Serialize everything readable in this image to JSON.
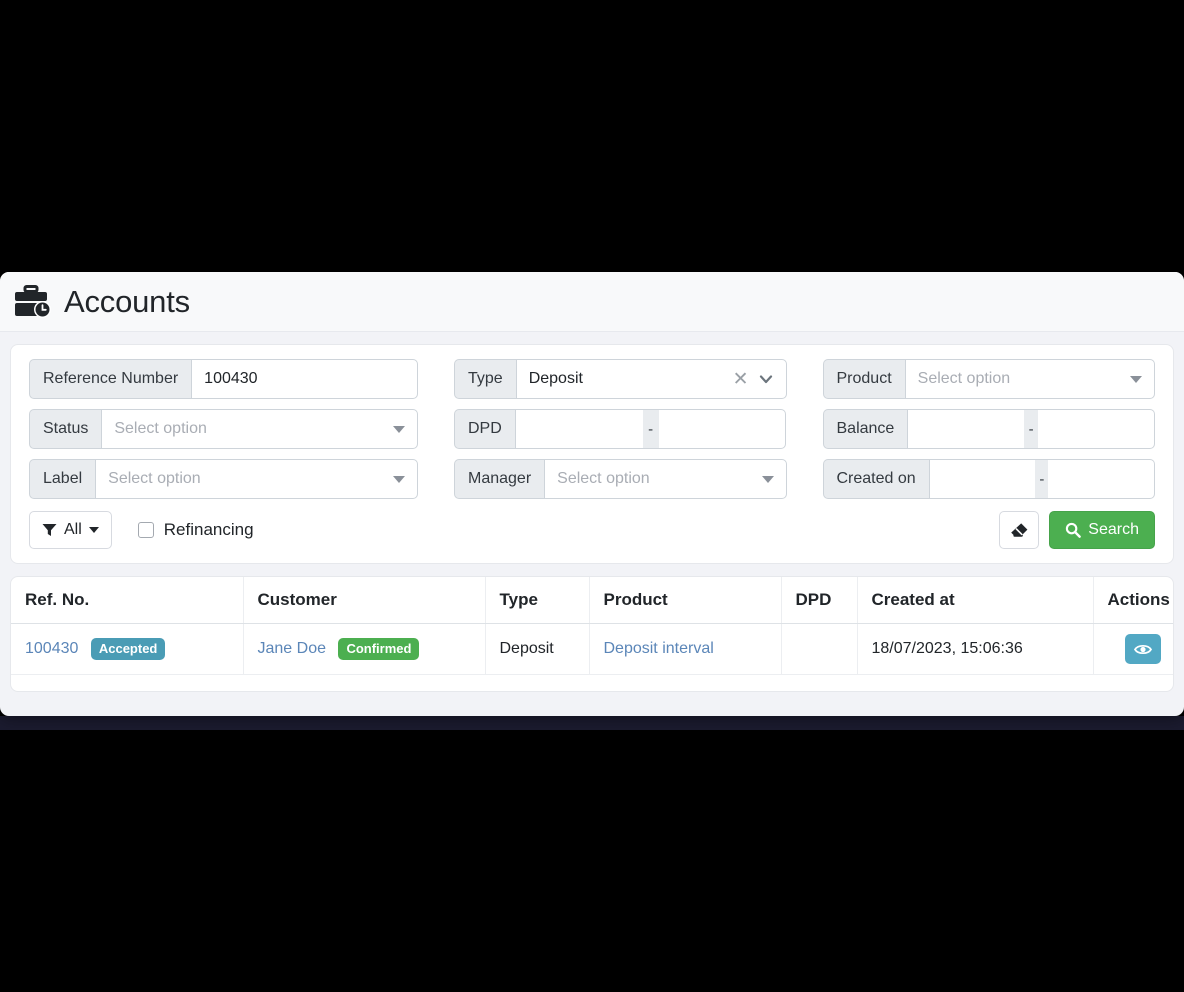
{
  "header": {
    "title": "Accounts",
    "icon": "briefcase-clock-icon"
  },
  "filters": {
    "reference_number": {
      "label": "Reference Number",
      "value": "100430"
    },
    "status": {
      "label": "Status",
      "placeholder": "Select option",
      "value": ""
    },
    "label": {
      "label": "Label",
      "placeholder": "Select option",
      "value": ""
    },
    "type": {
      "label": "Type",
      "value": "Deposit",
      "clear_icon": "close-icon",
      "chevron_icon": "chevron-down-icon"
    },
    "dpd": {
      "label": "DPD",
      "from": "",
      "to": "",
      "separator": "-"
    },
    "manager": {
      "label": "Manager",
      "placeholder": "Select option",
      "value": ""
    },
    "product": {
      "label": "Product",
      "placeholder": "Select option",
      "value": ""
    },
    "balance": {
      "label": "Balance",
      "from": "",
      "to": "",
      "separator": "-"
    },
    "created_on": {
      "label": "Created on",
      "from": "",
      "to": "",
      "separator": "-"
    }
  },
  "toolbar": {
    "all_filter_label": "All",
    "all_filter_icon": "funnel-icon",
    "refinancing_label": "Refinancing",
    "refinancing_checked": false,
    "clear_icon": "eraser-icon",
    "search_label": "Search",
    "search_icon": "search-icon"
  },
  "table": {
    "columns": [
      "Ref. No.",
      "Customer",
      "Type",
      "Product",
      "DPD",
      "Created at",
      "Actions"
    ],
    "rows": [
      {
        "ref_no": "100430",
        "ref_badge": "Accepted",
        "customer": "Jane Doe",
        "customer_badge": "Confirmed",
        "type": "Deposit",
        "product": "Deposit interval",
        "dpd": "",
        "created_at": "18/07/2023, 15:06:36",
        "action_icon": "eye-icon"
      }
    ]
  },
  "colors": {
    "accent_green": "#4caf50",
    "accent_teal": "#52a8c4",
    "badge_accepted": "#4a9cb5",
    "badge_confirmed": "#4caf50",
    "link": "#5b86b8"
  }
}
